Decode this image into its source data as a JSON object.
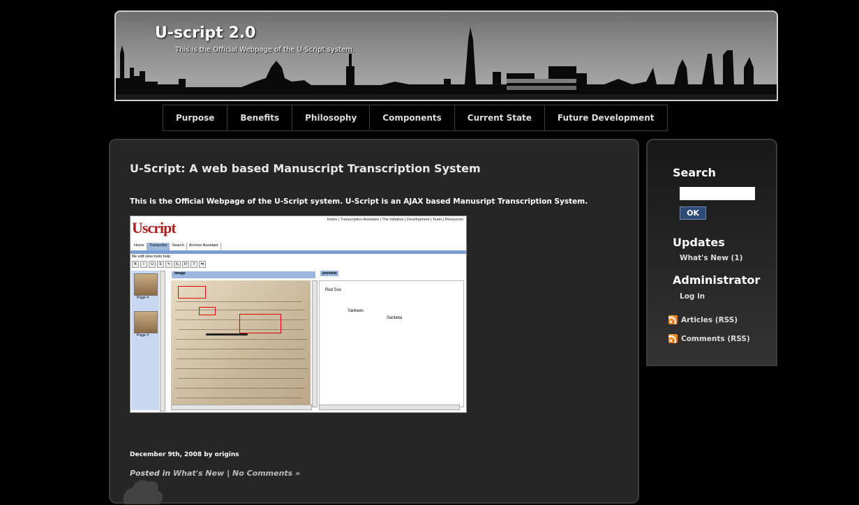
{
  "site": {
    "title": "U-script 2.0",
    "tagline": "This is the Official Webpage of the U-Script system."
  },
  "nav": {
    "tabs": [
      "Purpose",
      "Benefits",
      "Philosophy",
      "Components",
      "Current State",
      "Future Development"
    ]
  },
  "post": {
    "title": "U-Script: A web based Manuscript Transcription System",
    "intro": "This is the Official Webpage of the U-Script system. U-Script is an AJAX based Manusript Transcription System.",
    "meta": "December 9th, 2008 by origins",
    "footer_posted": "Posted in",
    "footer_category": "What's New",
    "footer_sep": "|",
    "footer_comments": "No Comments »"
  },
  "screenshot": {
    "logo": "Uscript",
    "top_links": "Home | Transcription Assistant | The Initiative | Development | Team | Resources",
    "tabs": [
      "Home",
      "Transcribe",
      "Search",
      "Archive Assistant"
    ],
    "menu": "file  edit  view  tools  help",
    "tools": [
      "B",
      "I",
      "U",
      "S",
      "✎",
      "X₂",
      "X²",
      "T",
      "⇆"
    ],
    "image_tab": "image",
    "preview_tab": "preview",
    "page_label": "Page #",
    "preview_words": [
      "Red Sox",
      "Yankees",
      "Santana"
    ]
  },
  "sidebar": {
    "search_heading": "Search",
    "search_value": "",
    "search_button": "OK",
    "updates_heading": "Updates",
    "updates_link": "What's New (1)",
    "admin_heading": "Administrator",
    "login_link": "Log in",
    "rss_articles": "Articles (RSS)",
    "rss_comments": "Comments (RSS)"
  }
}
